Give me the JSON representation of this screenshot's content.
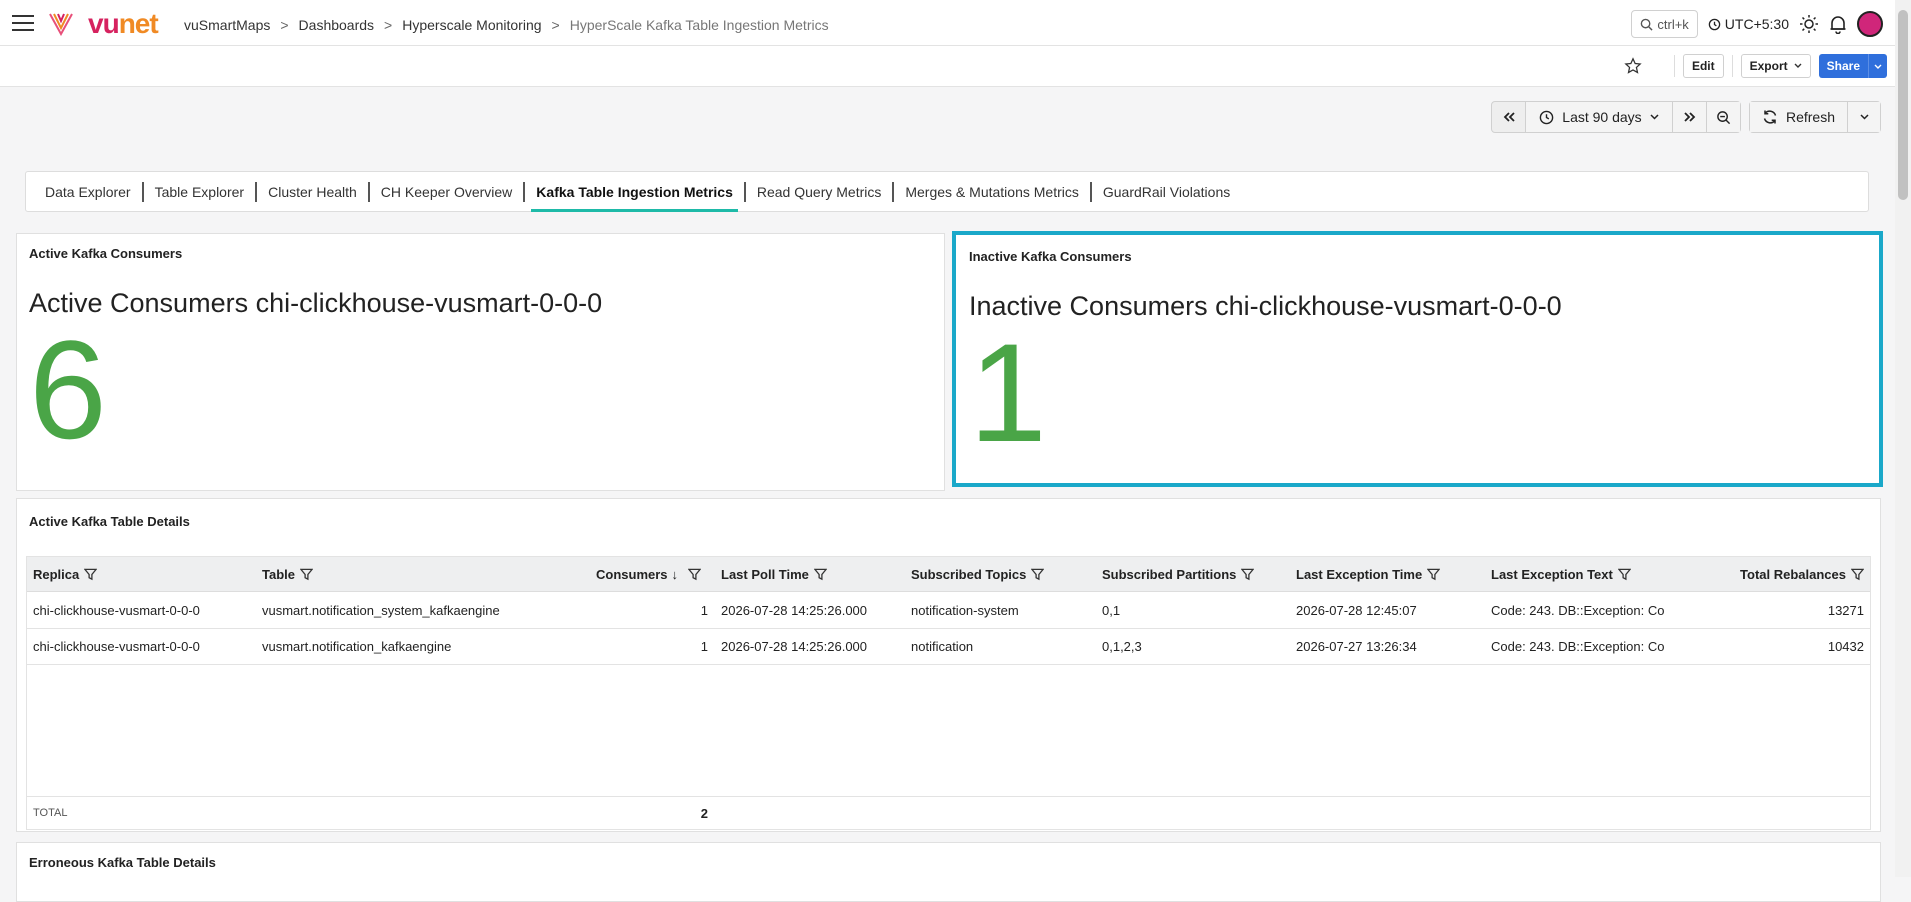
{
  "header": {
    "logo_vu": "vu",
    "logo_net": "net",
    "breadcrumbs": [
      "vuSmartMaps",
      "Dashboards",
      "Hyperscale Monitoring",
      "HyperScale Kafka Table Ingestion Metrics"
    ],
    "search_shortcut": "ctrl+k",
    "timezone": "UTC+5:30"
  },
  "actions": {
    "edit": "Edit",
    "export": "Export",
    "share": "Share"
  },
  "timebar": {
    "range": "Last 90 days",
    "refresh": "Refresh"
  },
  "tabs": [
    {
      "label": "Data Explorer",
      "active": false
    },
    {
      "label": "Table Explorer",
      "active": false
    },
    {
      "label": "Cluster Health",
      "active": false
    },
    {
      "label": "CH Keeper Overview",
      "active": false
    },
    {
      "label": "Kafka Table Ingestion Metrics",
      "active": true
    },
    {
      "label": "Read Query Metrics",
      "active": false
    },
    {
      "label": "Merges & Mutations Metrics",
      "active": false
    },
    {
      "label": "GuardRail Violations",
      "active": false
    }
  ],
  "active_panel": {
    "title": "Active Kafka Consumers",
    "stat_title": "Active Consumers chi-clickhouse-vusmart-0-0-0",
    "value": "6"
  },
  "inactive_panel": {
    "title": "Inactive Kafka Consumers",
    "stat_title": "Inactive Consumers chi-clickhouse-vusmart-0-0-0",
    "value": "1",
    "highlight_color": "#1aa8c9"
  },
  "table": {
    "title": "Active Kafka Table Details",
    "columns": [
      "Replica",
      "Table",
      "Consumers",
      "Last Poll Time",
      "Subscribed Topics",
      "Subscribed Partitions",
      "Last Exception Time",
      "Last Exception Text",
      "Total Rebalances"
    ],
    "sort_indicator": "↓",
    "rows": [
      [
        "chi-clickhouse-vusmart-0-0-0",
        "vusmart.notification_system_kafkaengine",
        "1",
        "2026-07-28 14:25:26.000",
        "notification-system",
        "0,1",
        "2026-07-28 12:45:07",
        "Code: 243. DB::Exception: Co",
        "13271"
      ],
      [
        "chi-clickhouse-vusmart-0-0-0",
        "vusmart.notification_kafkaengine",
        "1",
        "2026-07-28 14:25:26.000",
        "notification",
        "0,1,2,3",
        "2026-07-27 13:26:34",
        "Code: 243. DB::Exception: Co",
        "10432"
      ]
    ],
    "total_label": "TOTAL",
    "total_value": "2"
  },
  "bottom_panel": {
    "title": "Erroneous Kafka Table Details"
  },
  "colors": {
    "stat_green": "#4aa547",
    "tab_underline": "#1ebaa8",
    "share_blue": "#2f6fdc"
  }
}
